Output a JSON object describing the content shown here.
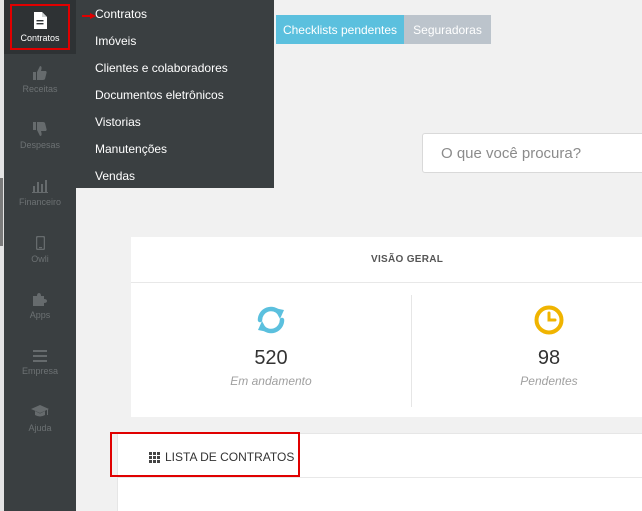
{
  "sidebar": {
    "items": [
      {
        "label": "Contratos",
        "icon": "document-icon",
        "active": true
      },
      {
        "label": "Receitas",
        "icon": "thumbs-up-icon"
      },
      {
        "label": "Despesas",
        "icon": "thumbs-down-icon"
      },
      {
        "label": "Financeiro",
        "icon": "bar-chart-icon"
      },
      {
        "label": "Owli",
        "icon": "mobile-icon"
      },
      {
        "label": "Apps",
        "icon": "puzzle-icon"
      },
      {
        "label": "Empresa",
        "icon": "menu-lines-icon"
      },
      {
        "label": "Ajuda",
        "icon": "graduation-cap-icon"
      }
    ]
  },
  "dropdown": {
    "items": [
      "Contratos",
      "Imóveis",
      "Clientes e colaboradores",
      "Documentos eletrônicos",
      "Vistorias",
      "Manutenções",
      "Vendas"
    ]
  },
  "tabs": {
    "pending_checklists": "Checklists pendentes",
    "insurers": "Seguradoras"
  },
  "search": {
    "placeholder": "O que você procura?"
  },
  "overview": {
    "title": "VISÃO GERAL",
    "stats": [
      {
        "value": "520",
        "caption": "Em andamento",
        "icon": "refresh-icon",
        "color": "#5bc0de"
      },
      {
        "value": "98",
        "caption": "Pendentes",
        "icon": "clock-icon",
        "color": "#f0b400"
      }
    ]
  },
  "list": {
    "title": "LISTA DE CONTRATOS",
    "icon": "grid-icon"
  },
  "colors": {
    "sidebar": "#3a3f41",
    "highlight": "#e00000",
    "accent_blue": "#5bc0de"
  }
}
